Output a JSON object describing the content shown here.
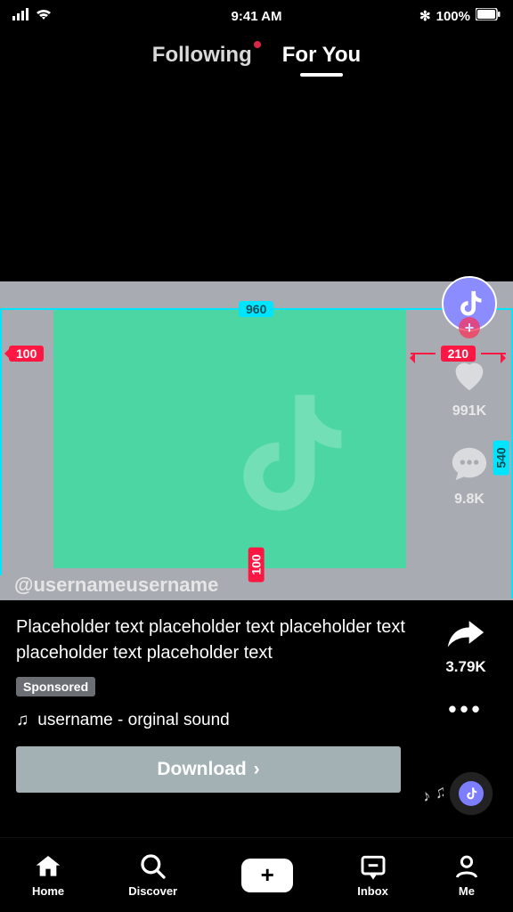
{
  "status": {
    "time": "9:41 AM",
    "battery": "100%",
    "bluetooth": "✻"
  },
  "tabs": {
    "following": "Following",
    "for_you": "For You"
  },
  "dims": {
    "top": "960",
    "left": "100",
    "right": "210",
    "bottom": "100",
    "height": "540"
  },
  "rail": {
    "likes": "991K",
    "comments": "9.8K"
  },
  "post": {
    "username": "@usernameusername",
    "caption": "Placeholder text placeholder text placeholder text placeholder text placeholder text",
    "sponsored": "Sponsored",
    "sound": "username - orginal sound",
    "cta": "Download",
    "shares": "3.79K"
  },
  "nav": {
    "home": "Home",
    "discover": "Discover",
    "inbox": "Inbox",
    "me": "Me"
  }
}
